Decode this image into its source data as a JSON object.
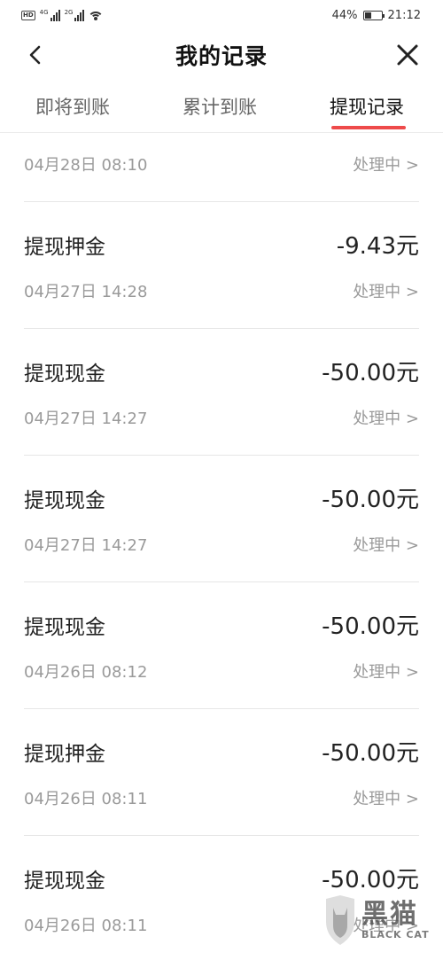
{
  "status_bar": {
    "hd": "HD",
    "net1": "4G",
    "net2": "2G",
    "battery": "44%",
    "battery_level": 0.44,
    "time": "21:12"
  },
  "header": {
    "title": "我的记录",
    "back_icon": "chevron-left-icon",
    "close_icon": "close-icon"
  },
  "tabs": [
    {
      "label": "即将到账",
      "active": false
    },
    {
      "label": "累计到账",
      "active": false
    },
    {
      "label": "提现记录",
      "active": true
    }
  ],
  "records": [
    {
      "type": "",
      "amount": "",
      "date": "04月28日 08:10",
      "status": "处理中 >"
    },
    {
      "type": "提现押金",
      "amount": "-9.43元",
      "date": "04月27日 14:28",
      "status": "处理中 >"
    },
    {
      "type": "提现现金",
      "amount": "-50.00元",
      "date": "04月27日 14:27",
      "status": "处理中 >"
    },
    {
      "type": "提现现金",
      "amount": "-50.00元",
      "date": "04月27日 14:27",
      "status": "处理中 >"
    },
    {
      "type": "提现现金",
      "amount": "-50.00元",
      "date": "04月26日 08:12",
      "status": "处理中 >"
    },
    {
      "type": "提现押金",
      "amount": "-50.00元",
      "date": "04月26日 08:11",
      "status": "处理中 >"
    },
    {
      "type": "提现现金",
      "amount": "-50.00元",
      "date": "04月26日 08:11",
      "status": "处理中 >"
    }
  ],
  "watermark": {
    "cn": "黑猫",
    "en": "BLACK CAT"
  },
  "colors": {
    "accent": "#ee4a4a",
    "muted_text": "#9a9a9a",
    "divider": "#e6e6e6"
  }
}
